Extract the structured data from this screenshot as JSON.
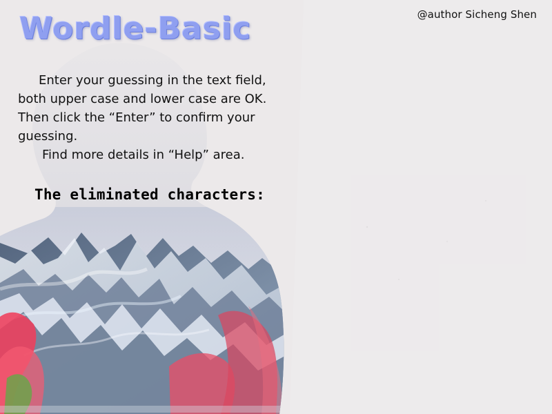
{
  "app": {
    "title": "Wordle-Basic",
    "author": "@author Sicheng Shen"
  },
  "instructions": {
    "paragraph_1": "Enter your guessing in the text field, both upper case and lower case are OK. Then click the “Enter” to confirm your guessing.",
    "paragraph_2": "Find more details in “Help” area."
  },
  "eliminated": {
    "label": "The eliminated characters:",
    "characters": ""
  },
  "colors": {
    "background": "#ece9ea",
    "title": "#8f9ff0",
    "text": "#111111"
  },
  "background_art": {
    "icon": "person-silhouette-mountain-art",
    "description_visible": false
  }
}
